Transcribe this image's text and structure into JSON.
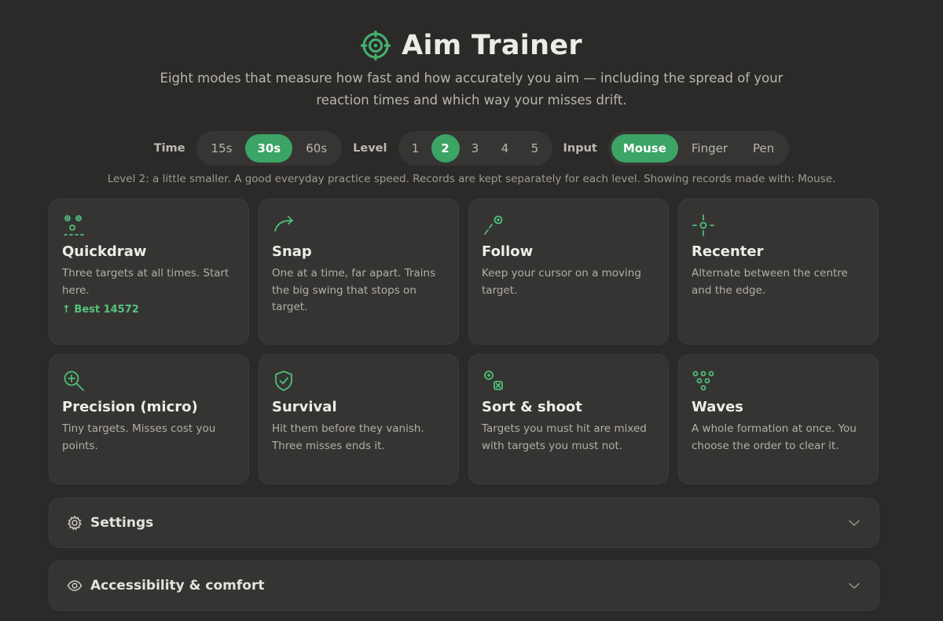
{
  "header": {
    "title": "Aim Trainer",
    "icon": "crosshair-icon",
    "subtitle": "Eight modes that measure how fast and how accurately you aim — including the spread of your reaction times and which way your misses drift."
  },
  "controls": {
    "time": {
      "label": "Time",
      "options": [
        "15s",
        "30s",
        "60s"
      ],
      "selected": "30s"
    },
    "level": {
      "label": "Level",
      "options": [
        "1",
        "2",
        "3",
        "4",
        "5"
      ],
      "selected": "2"
    },
    "input": {
      "label": "Input",
      "options": [
        "Mouse",
        "Finger",
        "Pen"
      ],
      "selected": "Mouse"
    }
  },
  "note": "Level 2: a little smaller. A good everyday practice speed. Records are kept separately for each level. Showing records made with: Mouse.",
  "modes": [
    {
      "title": "Quickdraw",
      "desc": "Three targets at all times. Start here.",
      "best": "↑ Best 14572",
      "icon": "three-targets-icon"
    },
    {
      "title": "Snap",
      "desc": "One at a time, far apart. Trains the big swing that stops on target.",
      "icon": "swing-arrow-icon"
    },
    {
      "title": "Follow",
      "desc": "Keep your cursor on a moving target.",
      "icon": "tracking-path-icon"
    },
    {
      "title": "Recenter",
      "desc": "Alternate between the centre and the edge.",
      "icon": "center-point-icon"
    },
    {
      "title": "Precision (micro)",
      "desc": "Tiny targets. Misses cost you points.",
      "icon": "magnifier-plus-icon"
    },
    {
      "title": "Survival",
      "desc": "Hit them before they vanish. Three misses ends it.",
      "icon": "shield-check-icon"
    },
    {
      "title": "Sort & shoot",
      "desc": "Targets you must hit are mixed with targets you must not.",
      "icon": "target-and-x-icon"
    },
    {
      "title": "Waves",
      "desc": "A whole formation at once. You choose the order to clear it.",
      "icon": "formation-dots-icon"
    }
  ],
  "panels": {
    "settings": {
      "label": "Settings",
      "icon": "gear-icon"
    },
    "accessibility": {
      "label": "Accessibility & comfort",
      "icon": "eye-icon"
    }
  },
  "colors": {
    "background": "#2b2a29",
    "card": "#353433",
    "accent": "#3ca465",
    "accent_text": "#56c47d"
  }
}
